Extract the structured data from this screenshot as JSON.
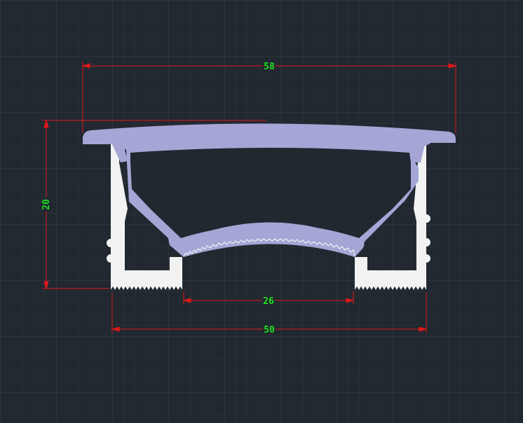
{
  "colors": {
    "background": "#212830",
    "grid_minor": "#2c343d",
    "grid_major": "#36404a",
    "dimension_line": "#e01818",
    "dimension_text": "#1fe01f",
    "profile_diffuser": "#a5a6d6",
    "profile_base": "#f2f2f2"
  },
  "dimensions": {
    "overall_width": "58",
    "height": "20",
    "inner_width": "26",
    "base_width": "50"
  }
}
